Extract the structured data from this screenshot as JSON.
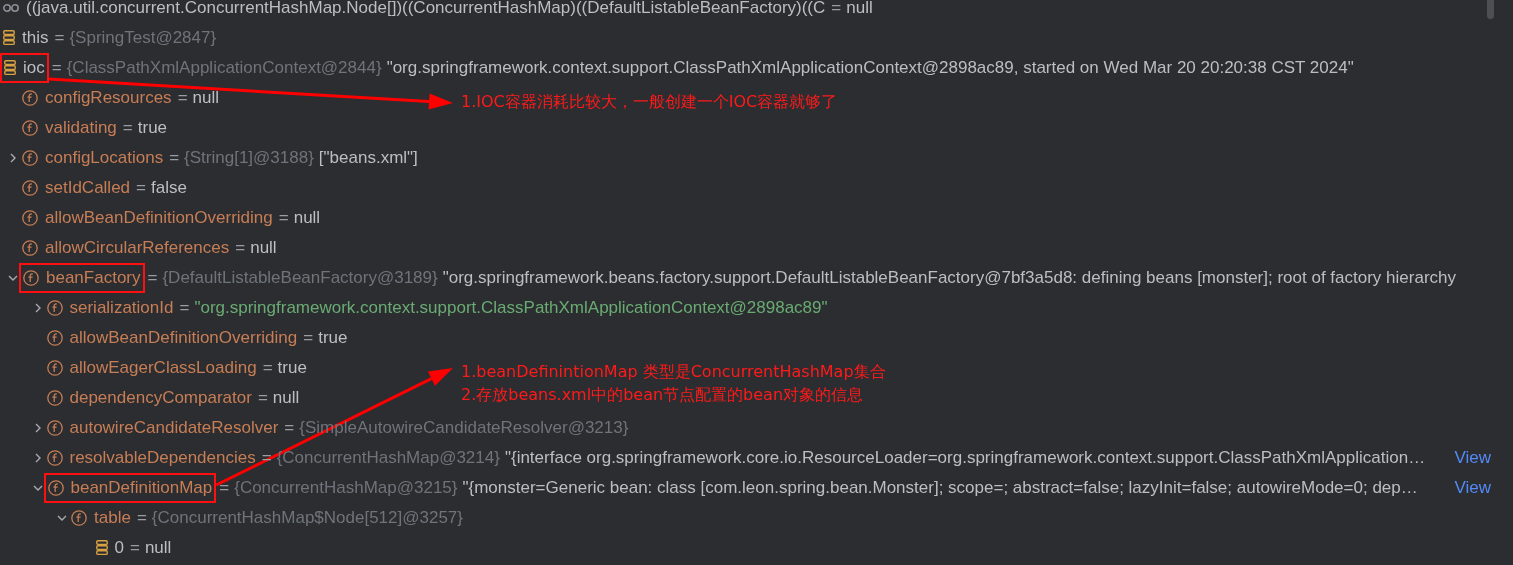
{
  "variables": [
    {
      "kind": "watch",
      "name": "((java.util.concurrent.ConcurrentHashMap.Node[])((ConcurrentHashMap)((DefaultListableBeanFactory)((C",
      "eq": "=",
      "value": "null",
      "string": false,
      "boxed": false
    },
    {
      "kind": "local",
      "name": "this",
      "eq": "=",
      "ref": "{SpringTest@2847}",
      "boxed": false
    },
    {
      "kind": "local",
      "name": "ioc",
      "eq": "=",
      "ref": "{ClassPathXmlApplicationContext@2844}",
      "value": "\"org.springframework.context.support.ClassPathXmlApplicationContext@2898ac89, started on Wed Mar 20 20:20:38 CST 2024\"",
      "string": false,
      "boxed": true,
      "children": [
        {
          "kind": "field",
          "name": "configResources",
          "eq": "=",
          "value": "null",
          "string": false,
          "boxed": false
        },
        {
          "kind": "field",
          "name": "validating",
          "eq": "=",
          "value": "true",
          "string": false,
          "boxed": false
        },
        {
          "kind": "field",
          "name": "configLocations",
          "eq": "=",
          "ref": "{String[1]@3188}",
          "value": "[\"beans.xml\"]",
          "string": false,
          "expanded": false,
          "boxed": false
        },
        {
          "kind": "field",
          "name": "setIdCalled",
          "eq": "=",
          "value": "false",
          "string": false,
          "boxed": false
        },
        {
          "kind": "field",
          "name": "allowBeanDefinitionOverriding",
          "eq": "=",
          "value": "null",
          "string": false,
          "boxed": false
        },
        {
          "kind": "field",
          "name": "allowCircularReferences",
          "eq": "=",
          "value": "null",
          "string": false,
          "boxed": false
        },
        {
          "kind": "field",
          "name": "beanFactory",
          "eq": "=",
          "ref": "{DefaultListableBeanFactory@3189}",
          "value": "\"org.springframework.beans.factory.support.DefaultListableBeanFactory@7bf3a5d8: defining beans [monster]; root of factory hierarchy",
          "string": false,
          "expanded": true,
          "boxed": true,
          "children": [
            {
              "kind": "field",
              "name": "serializationId",
              "eq": "=",
              "value": "\"org.springframework.context.support.ClassPathXmlApplicationContext@2898ac89\"",
              "string": true,
              "expanded": false,
              "boxed": false
            },
            {
              "kind": "field",
              "name": "allowBeanDefinitionOverriding",
              "eq": "=",
              "value": "true",
              "string": false,
              "boxed": false
            },
            {
              "kind": "field",
              "name": "allowEagerClassLoading",
              "eq": "=",
              "value": "true",
              "string": false,
              "boxed": false
            },
            {
              "kind": "field",
              "name": "dependencyComparator",
              "eq": "=",
              "value": "null",
              "string": false,
              "boxed": false
            },
            {
              "kind": "field",
              "name": "autowireCandidateResolver",
              "eq": "=",
              "ref": "{SimpleAutowireCandidateResolver@3213}",
              "expanded": false,
              "boxed": false
            },
            {
              "kind": "field",
              "name": "resolvableDependencies",
              "eq": "=",
              "ref": "{ConcurrentHashMap@3214}",
              "value": "\"{interface org.springframework.core.io.ResourceLoader=org.springframework.context.support.ClassPathXmlApplication…",
              "string": false,
              "link": "View",
              "expanded": false,
              "boxed": false
            },
            {
              "kind": "field",
              "name": "beanDefinitionMap",
              "eq": "=",
              "ref": "{ConcurrentHashMap@3215}",
              "value": "\"{monster=Generic bean: class [com.leon.spring.bean.Monster]; scope=; abstract=false; lazyInit=false; autowireMode=0; dep…",
              "string": false,
              "link": "View",
              "expanded": true,
              "boxed": true,
              "children": [
                {
                  "kind": "field",
                  "name": "table",
                  "eq": "=",
                  "ref": "{ConcurrentHashMap$Node[512]@3257}",
                  "expanded": true,
                  "boxed": false,
                  "children": [
                    {
                      "kind": "local",
                      "name": "0",
                      "eq": "=",
                      "value": "null",
                      "string": false,
                      "boxed": false
                    }
                  ]
                }
              ]
            }
          ]
        }
      ]
    }
  ],
  "notes": [
    {
      "lines": [
        "1.IOC容器消耗比较大，一般创建一个IOC容器就够了"
      ]
    },
    {
      "lines": [
        "1.beanDefinintionMap 类型是ConcurrentHashMap集合",
        "2.存放beans.xml中的bean节点配置的bean对象的信息"
      ]
    }
  ]
}
